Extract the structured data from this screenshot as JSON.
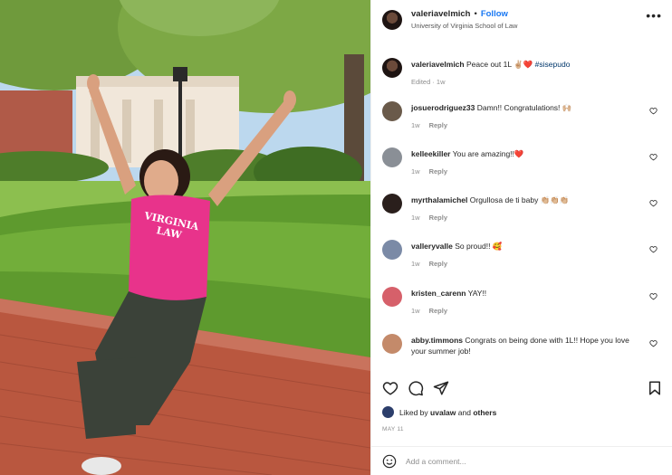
{
  "header": {
    "username": "valeriavelmich",
    "separator": "•",
    "follow_label": "Follow",
    "location": "University of Virginia School of Law",
    "more_label": "•••"
  },
  "caption": {
    "username": "valeriavelmich",
    "text": "Peace out 1L ✌🏼❤️",
    "hashtag": "#sisepudo",
    "meta": "Edited · 1w"
  },
  "comments": [
    {
      "username": "josuerodriguez33",
      "text": "Damn!! Congratulations! 🙌🏼",
      "time": "1w",
      "reply": "Reply",
      "avatar_color": "#6a5a4a"
    },
    {
      "username": "kelleekiller",
      "text": "You are amazing!!❤️",
      "time": "1w",
      "reply": "Reply",
      "avatar_color": "#8a8f96"
    },
    {
      "username": "myrthalamichel",
      "text": "Orgullosa de ti baby 👏🏼👏🏼👏🏼",
      "time": "1w",
      "reply": "Reply",
      "avatar_color": "#2a1f1c"
    },
    {
      "username": "valleryvalle",
      "text": "So proud!! 🥰",
      "time": "1w",
      "reply": "Reply",
      "avatar_color": "#7b8aa6"
    },
    {
      "username": "kristen_carenn",
      "text": "YAY!!",
      "time": "1w",
      "reply": "Reply",
      "avatar_color": "#d6606a"
    },
    {
      "username": "abby.timmons",
      "text": "Congrats on being done with 1L!! Hope you love your summer job!",
      "time": "",
      "reply": "",
      "avatar_color": "#c48a6a"
    }
  ],
  "likes": {
    "prefix": "Liked by",
    "user": "uvalaw",
    "and": "and",
    "others": "others"
  },
  "date": "MAY 11",
  "add_comment": {
    "placeholder": "Add a comment..."
  },
  "photo": {
    "shirt_line1": "VIRGINIA",
    "shirt_line2": "LAW",
    "shirt_color": "#e8338b"
  },
  "colors": {
    "link": "#1877f2",
    "hashtag": "#00376b",
    "muted": "#8e8e8e"
  }
}
